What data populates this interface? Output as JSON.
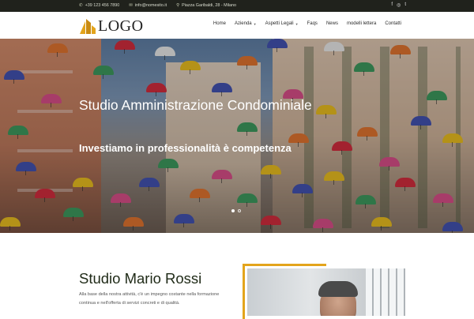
{
  "topbar": {
    "phone": "+39 123 456 7890",
    "email": "info@nomesito.it",
    "address": "Piazza Garibaldi, 28 - Milano",
    "social": [
      "f",
      "◎",
      "t"
    ]
  },
  "brand": {
    "logo_text": "LOGO"
  },
  "nav": {
    "items": [
      {
        "label": "Home",
        "dropdown": false
      },
      {
        "label": "Azienda",
        "dropdown": true
      },
      {
        "label": "Aspetti Legali",
        "dropdown": true
      },
      {
        "label": "Faqs",
        "dropdown": false
      },
      {
        "label": "News",
        "dropdown": false
      },
      {
        "label": "modelli lettera",
        "dropdown": false
      },
      {
        "label": "Contatti",
        "dropdown": false
      }
    ]
  },
  "hero": {
    "title": "Studio Amministrazione Condominiale",
    "subtitle": "Investiamo in professionalità è competenza",
    "slides": [
      true,
      false
    ]
  },
  "intro": {
    "title": "Studio Mario Rossi",
    "text": "Alla base della nostra attività, c'è un impegno costante nella formazione continua e nell'offerta di servizi concreti e di qualità."
  },
  "colors": {
    "topbar_bg": "#20221c",
    "accent": "#e3a41c",
    "heading": "#1f2a17"
  }
}
